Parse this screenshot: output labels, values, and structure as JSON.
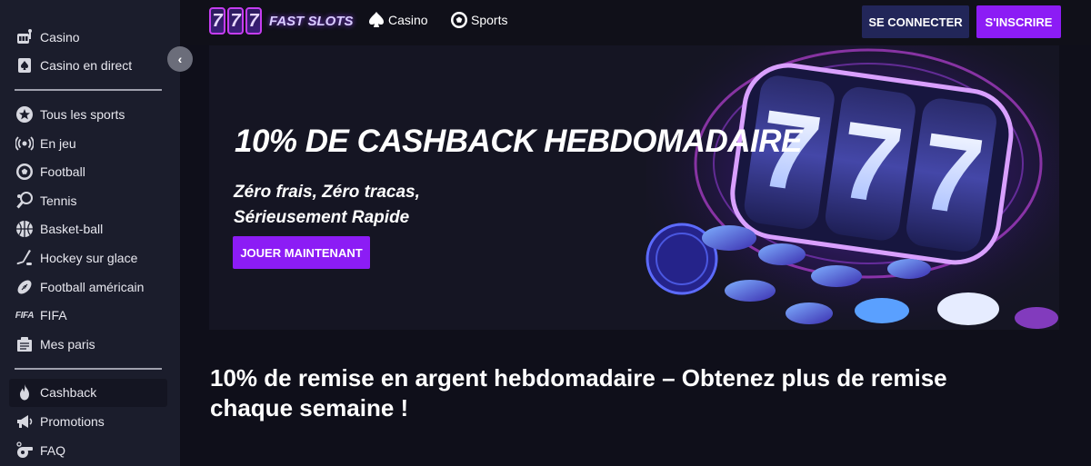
{
  "sidebar": {
    "group1": [
      {
        "label": "Casino",
        "icon": "casino-icon"
      },
      {
        "label": "Casino en direct",
        "icon": "live-casino-icon"
      }
    ],
    "group2": [
      {
        "label": "Tous les sports",
        "icon": "star-icon"
      },
      {
        "label": "En jeu",
        "icon": "live-signal-icon"
      },
      {
        "label": "Football",
        "icon": "soccer-ball-icon"
      },
      {
        "label": "Tennis",
        "icon": "tennis-racket-icon"
      },
      {
        "label": "Basket-ball",
        "icon": "basketball-icon"
      },
      {
        "label": "Hockey sur glace",
        "icon": "hockey-stick-icon"
      },
      {
        "label": "Football américain",
        "icon": "american-football-icon"
      },
      {
        "label": "FIFA",
        "icon": "fifa-icon"
      },
      {
        "label": "Mes paris",
        "icon": "my-bets-icon"
      }
    ],
    "group3": [
      {
        "label": "Cashback",
        "icon": "flame-icon"
      },
      {
        "label": "Promotions",
        "icon": "megaphone-icon"
      },
      {
        "label": "FAQ",
        "icon": "whistle-icon"
      }
    ],
    "fifa_badge": "FIFA"
  },
  "header": {
    "logo_digits": [
      "7",
      "7",
      "7"
    ],
    "logo_text": "FAST SLOTS",
    "nav": [
      {
        "label": "Casino",
        "icon": "spade-icon"
      },
      {
        "label": "Sports",
        "icon": "soccer-ball-icon"
      }
    ],
    "login_label": "SE CONNECTER",
    "signup_label": "S'INSCRIRE"
  },
  "hero": {
    "title": "10% DE CASHBACK HEBDOMADAIRE",
    "subtitle_line1": "Zéro frais, Zéro tracas,",
    "subtitle_line2": "Sérieusement Rapide",
    "cta_label": "JOUER MAINTENANT",
    "art_digits": [
      "7",
      "7",
      "7"
    ]
  },
  "article": {
    "title": "10% de remise en argent hebdomadaire – Obtenez plus de remise chaque semaine !"
  },
  "colors": {
    "accent": "#8c1cf5",
    "login_bg": "#222659",
    "sidebar_bg": "#1b1d2c",
    "page_bg": "#0f0f1a"
  }
}
